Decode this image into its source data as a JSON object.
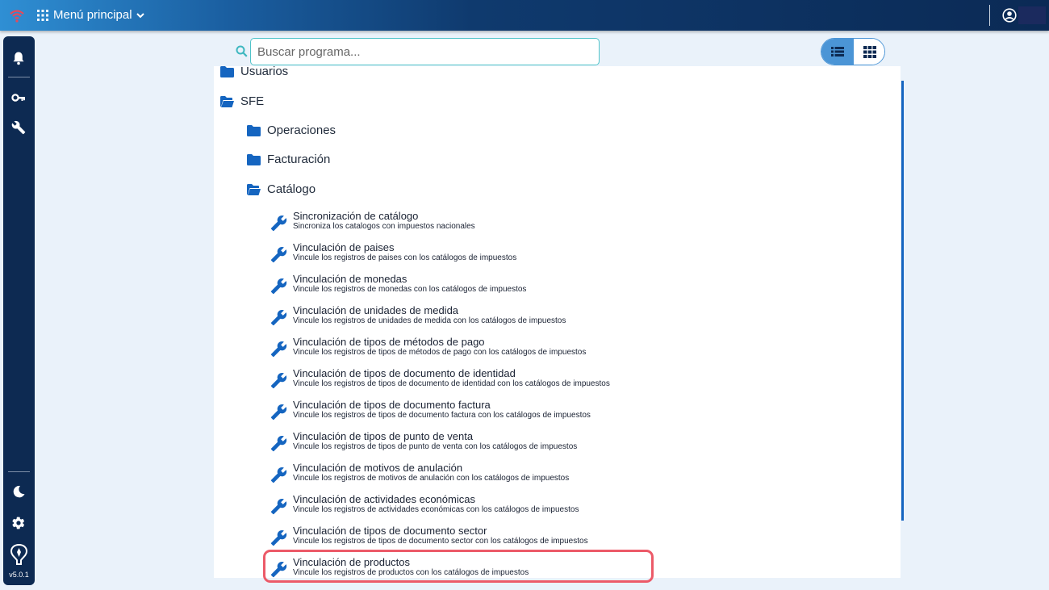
{
  "topbar": {
    "menu_title": "Menú principal"
  },
  "sidebar": {
    "version": "v5.0.1"
  },
  "search": {
    "placeholder": "Buscar programa..."
  },
  "tree": {
    "folders": {
      "usuarios": "Usuarios",
      "sfe": "SFE",
      "operaciones": "Operaciones",
      "facturacion": "Facturación",
      "catalogo": "Catálogo"
    },
    "programs": [
      {
        "title": "Sincronización de catálogo",
        "desc": "Sincroniza los catalogos con impuestos nacionales"
      },
      {
        "title": "Vinculación de paises",
        "desc": "Vincule los registros de paises con los catálogos de impuestos"
      },
      {
        "title": "Vinculación de monedas",
        "desc": "Vincule los registros de monedas con los catálogos de impuestos"
      },
      {
        "title": "Vinculación de unidades de medida",
        "desc": "Vincule los registros de unidades de medida con los catálogos de impuestos"
      },
      {
        "title": "Vinculación de tipos de métodos de pago",
        "desc": "Vincule los registros de tipos de métodos de pago con los catálogos de impuestos"
      },
      {
        "title": "Vinculación de tipos de documento de identidad",
        "desc": "Vincule los registros de tipos de documento de identidad con los catálogos de impuestos"
      },
      {
        "title": "Vinculación de tipos de documento factura",
        "desc": "Vincule los registros de tipos de documento factura con los catálogos de impuestos"
      },
      {
        "title": "Vinculación de tipos de punto de venta",
        "desc": "Vincule los registros de tipos de punto de venta con los catálogos de impuestos"
      },
      {
        "title": "Vinculación de motivos de anulación",
        "desc": "Vincule los registros de motivos de anulación con los catálogos de impuestos"
      },
      {
        "title": "Vinculación de actividades económicas",
        "desc": "Vincule los registros de actividades económicas con los catálogos de impuestos"
      },
      {
        "title": "Vinculación de tipos de documento sector",
        "desc": "Vincule los registros de tipos de documento sector con los catálogos de impuestos"
      },
      {
        "title": "Vinculación de productos",
        "desc": "Vincule los registros de productos con los catálogos de impuestos"
      }
    ]
  },
  "colors": {
    "accent": "#1565c0",
    "folder": "#1565c0",
    "highlight": "#ec5a68",
    "sidebar": "#0d2a52"
  },
  "icons": [
    "wifi-icon",
    "apps-icon",
    "chevron-down-icon",
    "user-icon",
    "bell-icon",
    "key-icon",
    "wrench-icon",
    "moon-icon",
    "gear-icon",
    "logo-icon",
    "search-icon",
    "list-view-icon",
    "grid-view-icon",
    "folder-icon",
    "folder-open-icon"
  ]
}
